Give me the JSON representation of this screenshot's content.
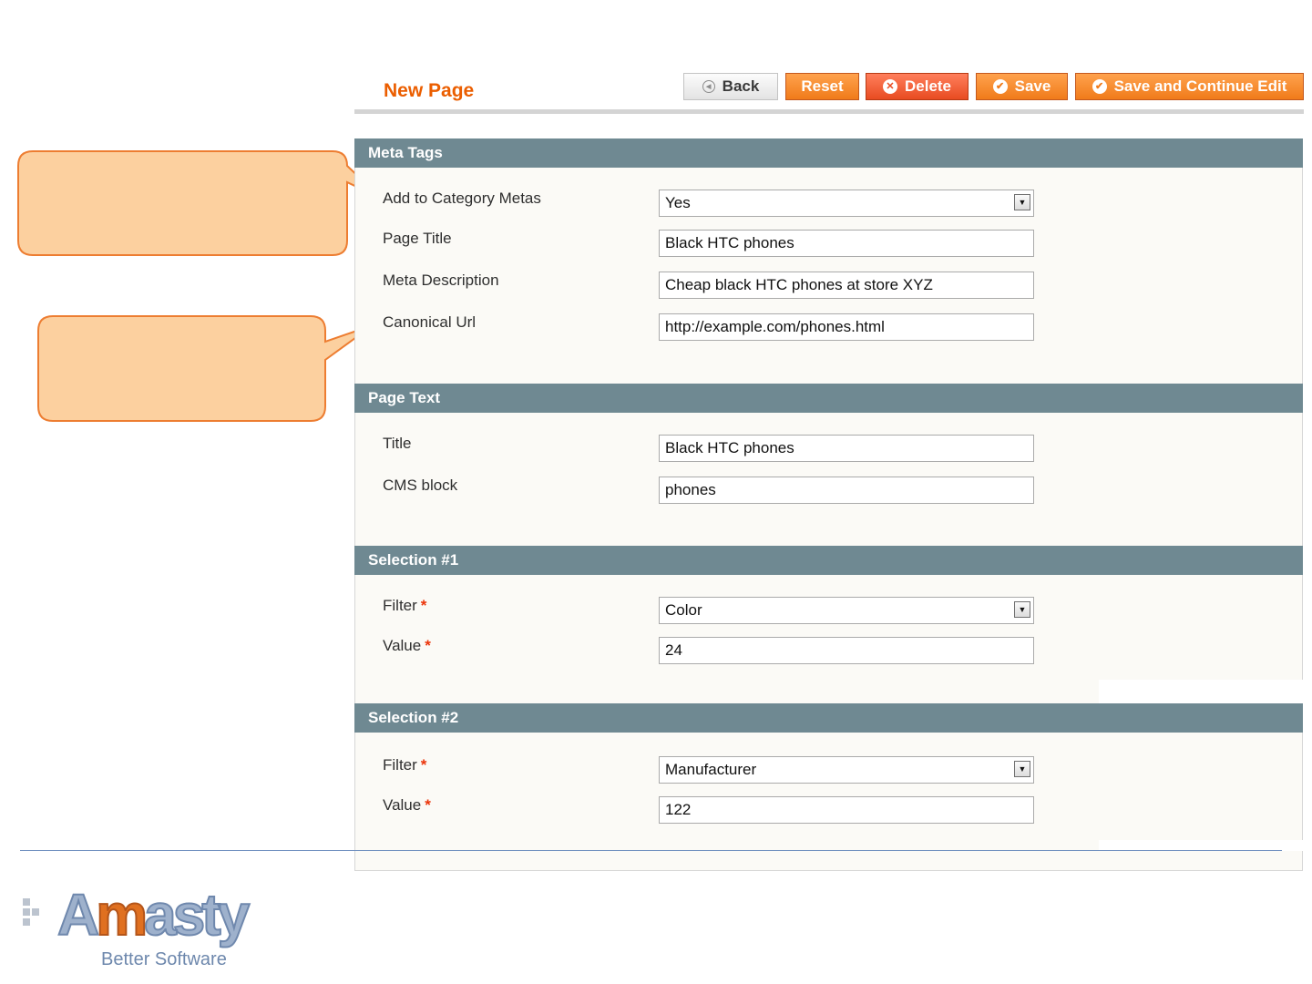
{
  "header": {
    "title": "New Page",
    "buttons": {
      "back": "Back",
      "reset": "Reset",
      "delete": "Delete",
      "save": "Save",
      "save_continue": "Save and Continue Edit"
    }
  },
  "sections": {
    "meta_tags": {
      "title": "Meta Tags",
      "add_to_category_metas": {
        "label": "Add to Category Metas",
        "value": "Yes"
      },
      "page_title": {
        "label": "Page Title",
        "value": "Black HTC phones"
      },
      "meta_description": {
        "label": "Meta Description",
        "value": "Cheap black HTC phones at store XYZ"
      },
      "canonical_url": {
        "label": "Canonical Url",
        "value": "http://example.com/phones.html"
      }
    },
    "page_text": {
      "title": "Page Text",
      "title_field": {
        "label": "Title",
        "value": "Black HTC phones"
      },
      "cms_block": {
        "label": "CMS block",
        "value": "phones"
      }
    },
    "selection_1": {
      "title": "Selection #1",
      "filter": {
        "label": "Filter",
        "value": "Color"
      },
      "value": {
        "label": "Value",
        "value": "24"
      }
    },
    "selection_2": {
      "title": "Selection #2",
      "filter": {
        "label": "Filter",
        "value": "Manufacturer"
      },
      "value": {
        "label": "Value",
        "value": "122"
      }
    }
  },
  "required_marker": "*",
  "logo": {
    "word": "Amasty",
    "tagline": "Better Software"
  },
  "colors": {
    "accent_orange": "#eb5e00",
    "button_orange": "#f07b1a",
    "delete_red": "#e84b21",
    "section_header": "#6f8992",
    "callout_fill": "#fcd09f",
    "callout_stroke": "#ed7d31"
  },
  "icons": {
    "back": "back-arrow-icon",
    "delete": "delete-circle-x-icon",
    "save": "check-circle-icon",
    "save_continue": "check-circle-icon",
    "select": "dropdown-arrow-icon"
  }
}
